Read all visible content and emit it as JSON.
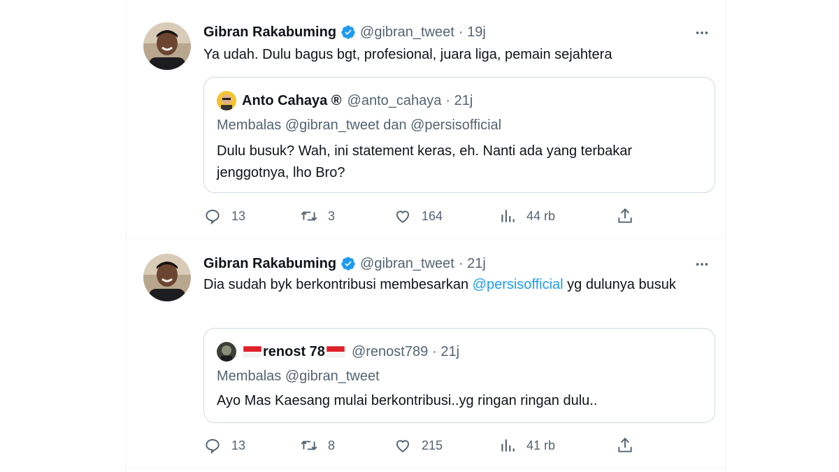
{
  "tweets": [
    {
      "author_name": "Gibran Rakabuming",
      "handle": "@gibran_tweet",
      "time": "· 19j",
      "text": "Ya udah. Dulu bagus bgt, profesional, juara liga, pemain sejahtera",
      "quote": {
        "author_name": "Anto Cahaya ®",
        "handle": "@anto_cahaya",
        "time": "· 21j",
        "replying_to": "Membalas @gibran_tweet dan @persisofficial",
        "text": "Dulu busuk? Wah, ini statement keras, eh. Nanti ada yang terbakar jenggotnya, lho Bro?"
      },
      "stats": {
        "replies": "13",
        "retweets": "3",
        "likes": "164",
        "views": "44 rb"
      }
    },
    {
      "author_name": "Gibran Rakabuming",
      "handle": "@gibran_tweet",
      "time": "· 21j",
      "text_before": "Dia sudah byk berkontribusi membesarkan ",
      "mention": "@persisofficial",
      "text_after": " yg dulunya busuk",
      "quote": {
        "author_name": "renost 78",
        "handle": "@renost789",
        "time": "· 21j",
        "replying_to": "Membalas @gibran_tweet",
        "text": "Ayo Mas Kaesang mulai berkontribusi..yg ringan ringan dulu.."
      },
      "stats": {
        "replies": "13",
        "retweets": "8",
        "likes": "215",
        "views": "41 rb"
      }
    }
  ],
  "icons": {
    "verified": "verified-badge-icon",
    "more": "more-options-icon",
    "reply": "reply-icon",
    "retweet": "retweet-icon",
    "like": "heart-icon",
    "views": "views-icon",
    "share": "share-icon"
  },
  "colors": {
    "accent": "#1d9bf0",
    "secondary_text": "#536471",
    "border": "#cfd9de"
  }
}
